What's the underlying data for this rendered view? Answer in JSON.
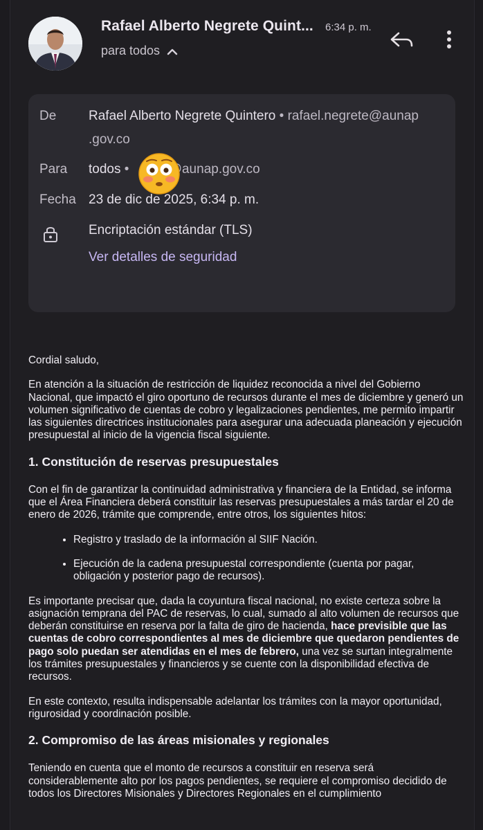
{
  "header": {
    "sender_name": "Rafael Alberto Negrete Quint...",
    "time": "6:34 p. m.",
    "recipients_summary": "para todos"
  },
  "details": {
    "from_label": "De",
    "from_name": "Rafael Alberto Negrete Quintero",
    "from_sep": "•",
    "from_email_line1": "rafael.negrete@aunap",
    "from_email_line2": ".gov.co",
    "to_label": "Para",
    "to_name": "todos",
    "to_sep": "•",
    "to_email_visible": "@aunap.gov.co",
    "date_label": "Fecha",
    "date_value": "23 de dic de 2025, 6:34 p. m.",
    "encryption": "Encriptación estándar (TLS)",
    "security_link": "Ver detalles de seguridad"
  },
  "body": {
    "greeting": "Cordial saludo,",
    "para1": "En atención a la situación de restricción de liquidez reconocida a nivel del Gobierno Nacional, que impactó el giro oportuno de recursos durante el mes de diciembre y generó un volumen significativo de cuentas de cobro y legalizaciones pendientes, me permito impartir las siguientes directrices institucionales para asegurar una adecuada planeación y ejecución presupuestal al inicio de la vigencia fiscal siguiente.",
    "heading1": "1. Constitución de reservas presupuestales",
    "para2": "Con el fin de garantizar la continuidad administrativa y financiera de la Entidad, se informa que el Área Financiera deberá constituir las reservas presupuestales a más tardar el 20 de enero de 2026, trámite que comprende, entre otros, los siguientes hitos:",
    "bullets": [
      "Registro y traslado de la información al SIIF Nación.",
      "Ejecución de la cadena presupuestal correspondiente (cuenta por pagar, obligación y posterior pago de recursos)."
    ],
    "para3_start": "Es importante precisar que, dada la coyuntura fiscal nacional, no existe certeza sobre la asignación temprana del PAC de reservas, lo cual, sumado al alto volumen de recursos que deberán constituirse en reserva por la falta de giro de hacienda, ",
    "para3_bold": "hace previsible que las cuentas de cobro correspondientes al mes de diciembre que quedaron pendientes de pago solo puedan ser atendidas en el mes de febrero,",
    "para3_end": " una vez se surtan integralmente los trámites presupuestales y financieros y se cuente con la disponibilidad efectiva de recursos.",
    "para4": "En este contexto, resulta indispensable adelantar los trámites con la mayor oportunidad, rigurosidad y coordinación posible.",
    "heading2": "2. Compromiso de las áreas misionales y regionales",
    "para5": "Teniendo en cuenta que el monto de recursos a constituir en reserva será considerablemente alto por los pagos pendientes, se requiere el compromiso decidido de todos los Directores Misionales y Directores Regionales en el cumplimiento"
  }
}
